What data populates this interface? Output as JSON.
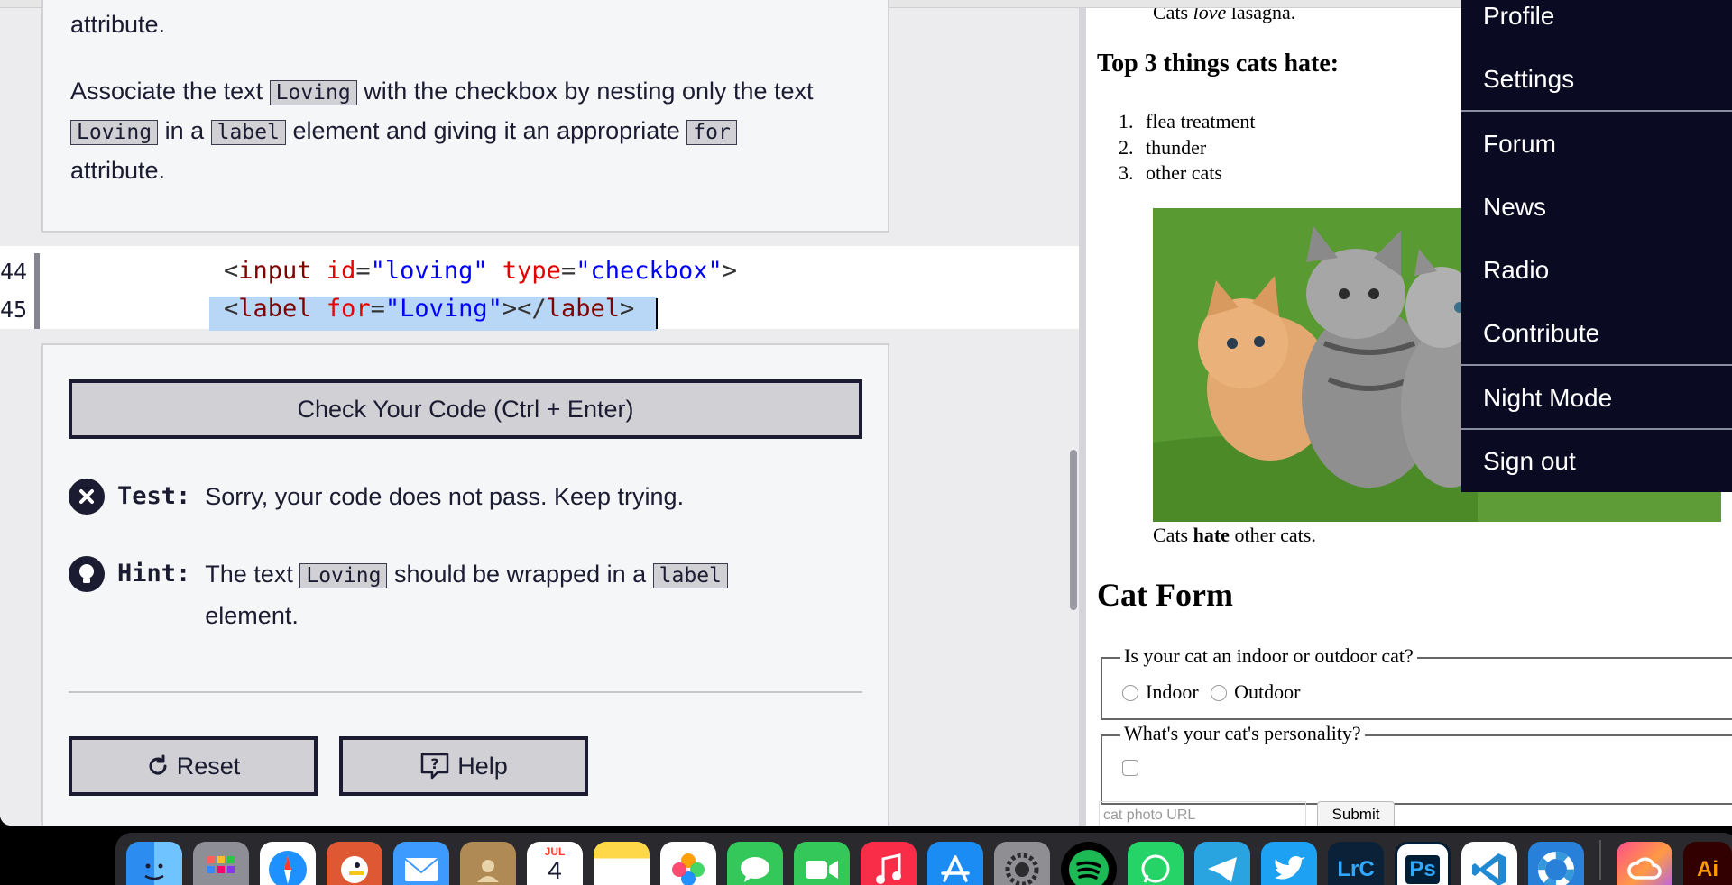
{
  "instructions": {
    "line1": "attribute.",
    "para2": {
      "part1": "Associate the text",
      "code1": "Loving",
      "part2": "with the checkbox by nesting only the text",
      "code2": "Loving",
      "part3": "in a",
      "code3": "label",
      "part4": "element and giving it an appropriate",
      "code4": "for",
      "part5": "attribute."
    }
  },
  "editor": {
    "lines": [
      {
        "num": "44",
        "open": "<",
        "tag": "input",
        "attr1": "id",
        "eq1": "=",
        "val1": "\"loving\"",
        "attr2": "type",
        "eq2": "=",
        "val2": "\"checkbox\"",
        "close": ">"
      },
      {
        "num": "45",
        "open": "<",
        "tag": "label",
        "attr1": "for",
        "eq1": "=",
        "val1": "\"Loving\"",
        "mid": "></",
        "tag2": "label",
        "close": ">"
      }
    ]
  },
  "results": {
    "check_button": "Check Your Code (Ctrl + Enter)",
    "test_label": "Test:",
    "test_text": "Sorry, your code does not pass. Keep trying.",
    "hint_label": "Hint:",
    "hint_part1": "The text",
    "hint_code1": "Loving",
    "hint_part2": "should be wrapped in a",
    "hint_code2": "label",
    "hint_part3": "element.",
    "reset_button": "Reset",
    "help_button": "Help"
  },
  "preview": {
    "caption_top_pre": "Cats ",
    "caption_top_em": "love",
    "caption_top_post": " lasagna.",
    "hate_heading": "Top 3 things cats hate:",
    "hate_items": [
      "flea treatment",
      "thunder",
      "other cats"
    ],
    "hate_nums": [
      "1.",
      "2.",
      "3."
    ],
    "kitten_caption_pre": "Cats ",
    "kitten_caption_strong": "hate",
    "kitten_caption_post": " other cats.",
    "form_title": "Cat Form",
    "fieldset1_legend": "Is your cat an indoor or outdoor cat?",
    "radio1": "Indoor",
    "radio2": "Outdoor",
    "fieldset2_legend": "What's your cat's personality?",
    "url_placeholder": "cat photo URL",
    "submit": "Submit"
  },
  "nav_menu": [
    "Profile",
    "Settings",
    "Forum",
    "News",
    "Radio",
    "Contribute",
    "Night Mode",
    "Sign out"
  ],
  "dock": {
    "calendar_month": "JUL",
    "calendar_day": "4",
    "lrc_label": "LrC",
    "ps_label": "Ps",
    "ai_label": "Ai"
  }
}
